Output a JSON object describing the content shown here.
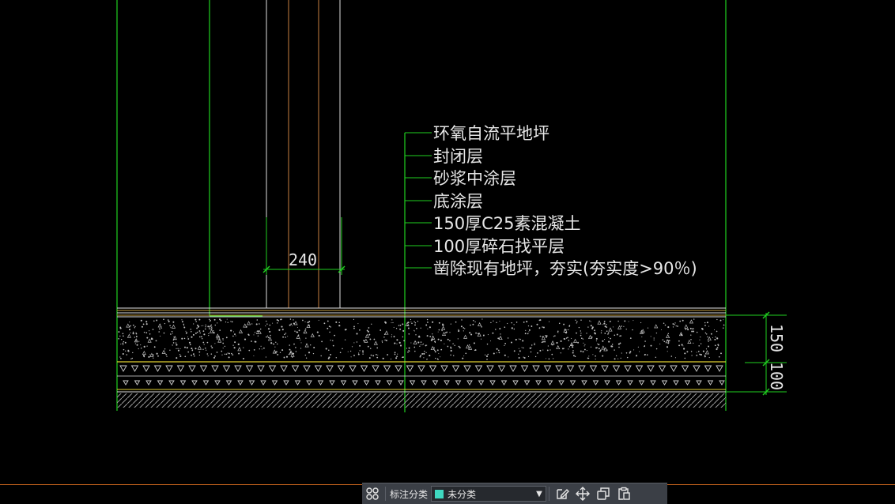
{
  "drawing": {
    "annotations": [
      "环氧自流平地坪",
      "封闭层",
      "砂浆中涂层",
      "底涂层",
      "150厚C25素混凝土",
      "100厚碎石找平层",
      "凿除现有地坪，夯实(夯实度>90％)"
    ],
    "dimensions": {
      "wall_width": "240",
      "concrete_thickness": "150",
      "gravel_thickness": "100"
    }
  },
  "toolbar": {
    "label": "标注分类",
    "selected_category": "未分类",
    "swatch_color": "#3fd8c0"
  }
}
